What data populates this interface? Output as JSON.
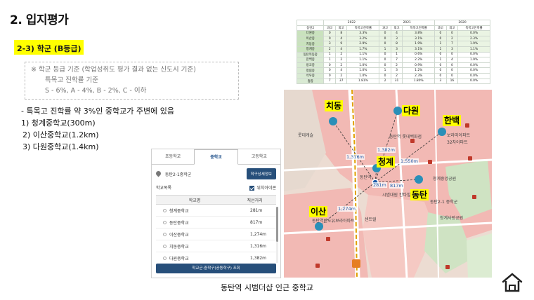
{
  "slide": {
    "title": "2. 입지평가",
    "subtitle": "2-3) 학군 (B등급)",
    "criteria": [
      "※ 학군 등급 기준 (학업성취도 평가 결과 없는 신도시 기준)",
      "특목고 진학률 기준",
      "S - 6%, A - 4%, B - 2%, C - 이하"
    ],
    "bullets": [
      "- 특목고 진학률 약 3%인 중학교가 주변에 있음",
      "1) 청계중학교(300m)",
      "2) 이산중학교(1.2km)",
      "3) 다원중학교(1.4km)"
    ],
    "map_caption": "동탄역 시범더샵 인근 중학교"
  },
  "panel": {
    "tabs": [
      "초등학교",
      "중학교",
      "고등학교"
    ],
    "active_tab": "중학교",
    "location": "동탄2-1중학군",
    "detail_button": "학구상세정보",
    "list_label": "학교목록",
    "checkbox_label": "위치아이콘",
    "col_name": "학교명",
    "col_distance": "직선거리",
    "schools": [
      {
        "name": "청계중학교",
        "distance": "281m"
      },
      {
        "name": "동탄중학교",
        "distance": "817m"
      },
      {
        "name": "이산중학교",
        "distance": "1,274m"
      },
      {
        "name": "치동중학교",
        "distance": "1,316m"
      },
      {
        "name": "다원중학교",
        "distance": "1,382m"
      }
    ],
    "search_button": "학교군·중학구(공동학구) 조회"
  },
  "table": {
    "years": [
      "2022",
      "2021",
      "2020"
    ],
    "headers": [
      "동탄2",
      "과고",
      "외고",
      "특목고진학률",
      "과고",
      "외고",
      "특목고진학률",
      "과고",
      "외고",
      "특목고진학률"
    ],
    "rows": [
      [
        "다원중",
        "0",
        "8",
        "3.3%",
        "0",
        "4",
        "3.8%",
        "0",
        "0",
        "0.0%"
      ],
      [
        "이산중",
        "0",
        "4",
        "3.2%",
        "0",
        "3",
        "3.1%",
        "0",
        "2",
        "2.3%"
      ],
      [
        "치동중",
        "3",
        "9",
        "2.9%",
        "0",
        "8",
        "1.9%",
        "1",
        "7",
        "1.9%"
      ],
      [
        "청계중",
        "2",
        "4",
        "1.7%",
        "1",
        "3",
        "3.1%",
        "1",
        "3",
        "1.1%"
      ],
      [
        "동탄목동중",
        "1",
        "2",
        "1.1%",
        "0",
        "1",
        "0.6%",
        "0",
        "0",
        "0.0%"
      ],
      [
        "한백중",
        "1",
        "2",
        "1.1%",
        "0",
        "7",
        "2.2%",
        "1",
        "4",
        "1.9%"
      ],
      [
        "방교중",
        "0",
        "2",
        "1.0%",
        "0",
        "2",
        "0.9%",
        "0",
        "0",
        "0.0%"
      ],
      [
        "청림중",
        "0",
        "4",
        "1.0%",
        "1",
        "3",
        "1.2%",
        "0",
        "0",
        "0.0%"
      ],
      [
        "석우중",
        "0",
        "2",
        "1.0%",
        "0",
        "2",
        "2.3%",
        "0",
        "0",
        "0.0%"
      ],
      [
        "총합",
        "7",
        "37",
        "1.81%",
        "2",
        "31",
        "1.80%",
        "3",
        "16",
        "0.0%"
      ]
    ],
    "highlight_rows": [
      0,
      1,
      2,
      3
    ]
  },
  "map": {
    "labels": [
      "치동",
      "다원",
      "한백",
      "청계",
      "동탄",
      "이산"
    ],
    "distances": [
      "1,316m",
      "1,382m",
      "1,550m",
      "281m",
      "817m",
      "1,274m"
    ],
    "place_texts": [
      "롯데캐슬",
      "동탄역 롯데백화점",
      "시범대원 칸타빌 아파트",
      "동탄2-1 중학군",
      "청계중앙공원",
      "청계사랑공원",
      "동탄역",
      "보라미아파트",
      "32차아파트",
      "동탄역반도유보라아파트",
      "센트럴"
    ],
    "colors": {
      "residential": "#f2b9b4",
      "park": "#cfe3c3",
      "road": "#ffffff",
      "rail": "#e0a000",
      "marker": "#2a8fb8"
    }
  }
}
